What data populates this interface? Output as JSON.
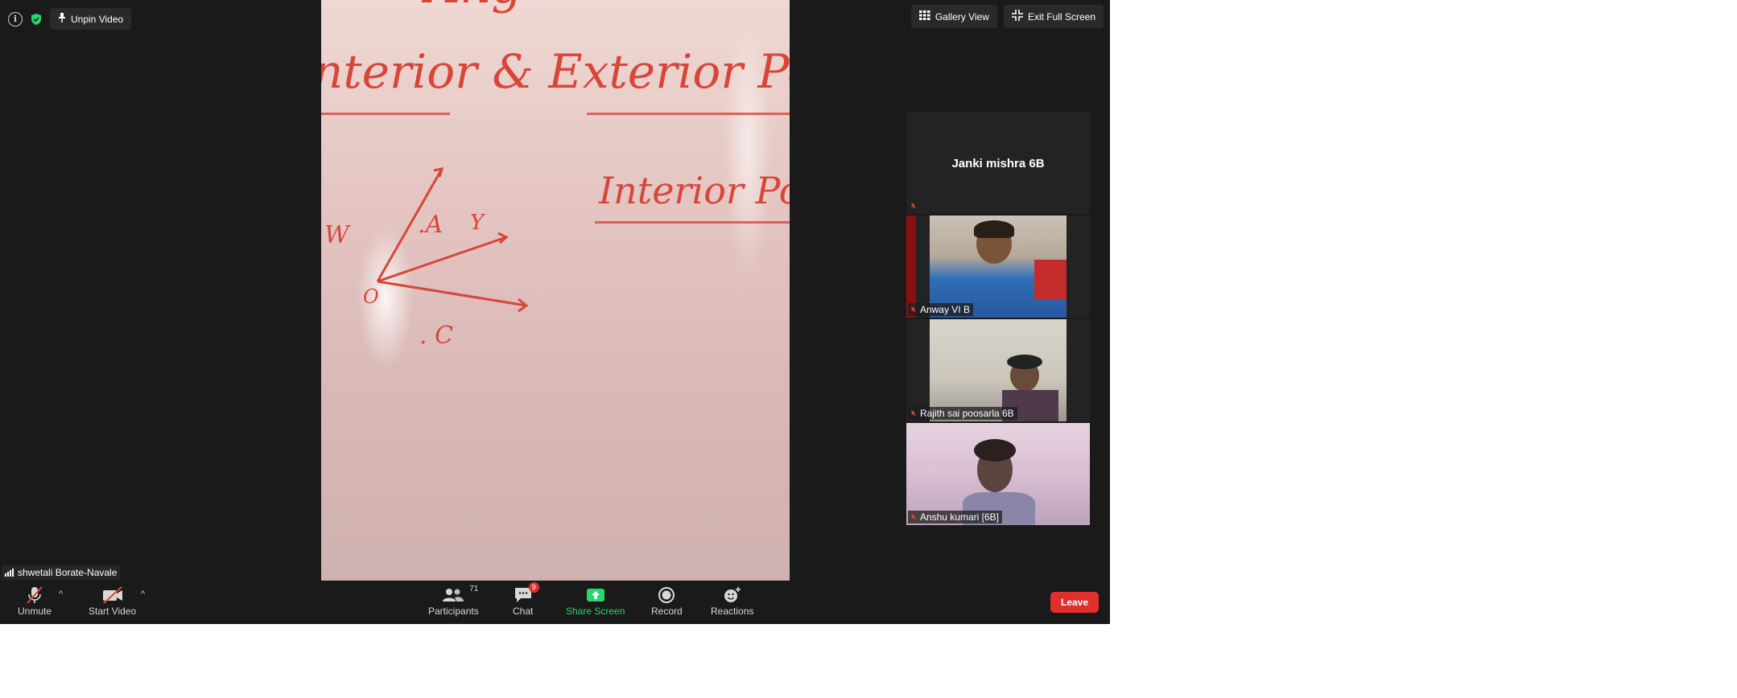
{
  "top_bar": {
    "unpin_label": "Unpin Video",
    "gallery_view_label": "Gallery View",
    "exit_fullscreen_label": "Exit Full Screen"
  },
  "main_video": {
    "board_text_1": "nterior & Exterior Poin",
    "board_text_2": "Interior Po",
    "board_labels": [
      "W",
      ".A",
      "Y",
      "O",
      ". C"
    ]
  },
  "speaker": {
    "name": "shwetali Borate-Navale"
  },
  "participants_strip": [
    {
      "name": "Janki mishra 6B",
      "video": false,
      "muted": true
    },
    {
      "name": "Anway VI B",
      "video": true,
      "muted": true
    },
    {
      "name": "Rajith sai poosarla 6B",
      "video": true,
      "muted": true
    },
    {
      "name": "Anshu kumari [6B]",
      "video": true,
      "muted": true
    }
  ],
  "toolbar": {
    "unmute_label": "Unmute",
    "start_video_label": "Start Video",
    "participants_label": "Participants",
    "participants_count": "71",
    "chat_label": "Chat",
    "chat_badge": "9",
    "share_label": "Share Screen",
    "record_label": "Record",
    "reactions_label": "Reactions",
    "leave_label": "Leave"
  },
  "colors": {
    "share_accent": "#23d96e",
    "leave_red": "#e0302b",
    "muted_red": "#e2443a"
  }
}
